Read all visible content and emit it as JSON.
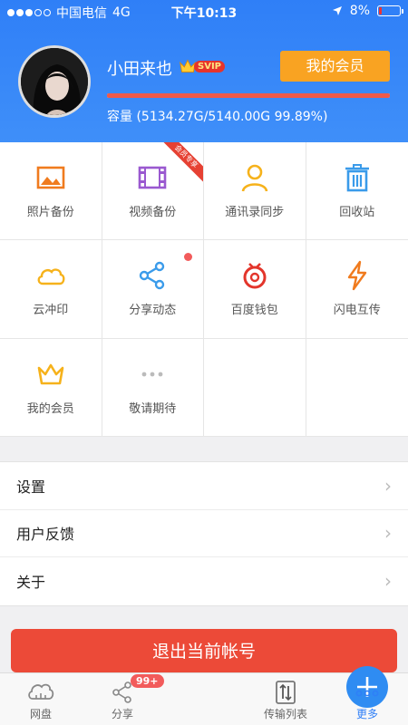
{
  "status_bar": {
    "carrier": "中国电信",
    "network": "4G",
    "time": "下午10:13",
    "battery": "8%"
  },
  "profile": {
    "username": "小田来也",
    "vip_label": "SVIP",
    "member_button": "我的会员",
    "quota_text": "容量 (5134.27G/5140.00G 99.89%)",
    "quota_fraction": 0.9989
  },
  "grid": {
    "ribbon": "会员专享",
    "items": [
      {
        "label": "照片备份",
        "icon": "photo-icon",
        "color": "#f07b1e"
      },
      {
        "label": "视频备份",
        "icon": "film-icon",
        "color": "#9a59d0"
      },
      {
        "label": "通讯录同步",
        "icon": "contact-icon",
        "color": "#f6b21b"
      },
      {
        "label": "回收站",
        "icon": "trash-icon",
        "color": "#3a9bea"
      },
      {
        "label": "云冲印",
        "icon": "cloud-icon",
        "color": "#f6b21b"
      },
      {
        "label": "分享动态",
        "icon": "share-icon",
        "color": "#3a9bea"
      },
      {
        "label": "百度钱包",
        "icon": "wallet-icon",
        "color": "#e3352b"
      },
      {
        "label": "闪电互传",
        "icon": "lightning-icon",
        "color": "#f07b1e"
      },
      {
        "label": "我的会员",
        "icon": "crown-icon",
        "color": "#f6b21b"
      },
      {
        "label": "敬请期待",
        "icon": "more-dots-icon",
        "color": "#bbbbbb"
      }
    ]
  },
  "settings_list": [
    "设置",
    "用户反馈",
    "关于"
  ],
  "logout_label": "退出当前帐号",
  "tabbar": {
    "tabs": [
      "网盘",
      "分享",
      "传输列表",
      "更多"
    ],
    "share_badge": "99+"
  },
  "colors": {
    "primary": "#2f7ff7",
    "accent": "#f9a322",
    "danger": "#ec4a38"
  }
}
